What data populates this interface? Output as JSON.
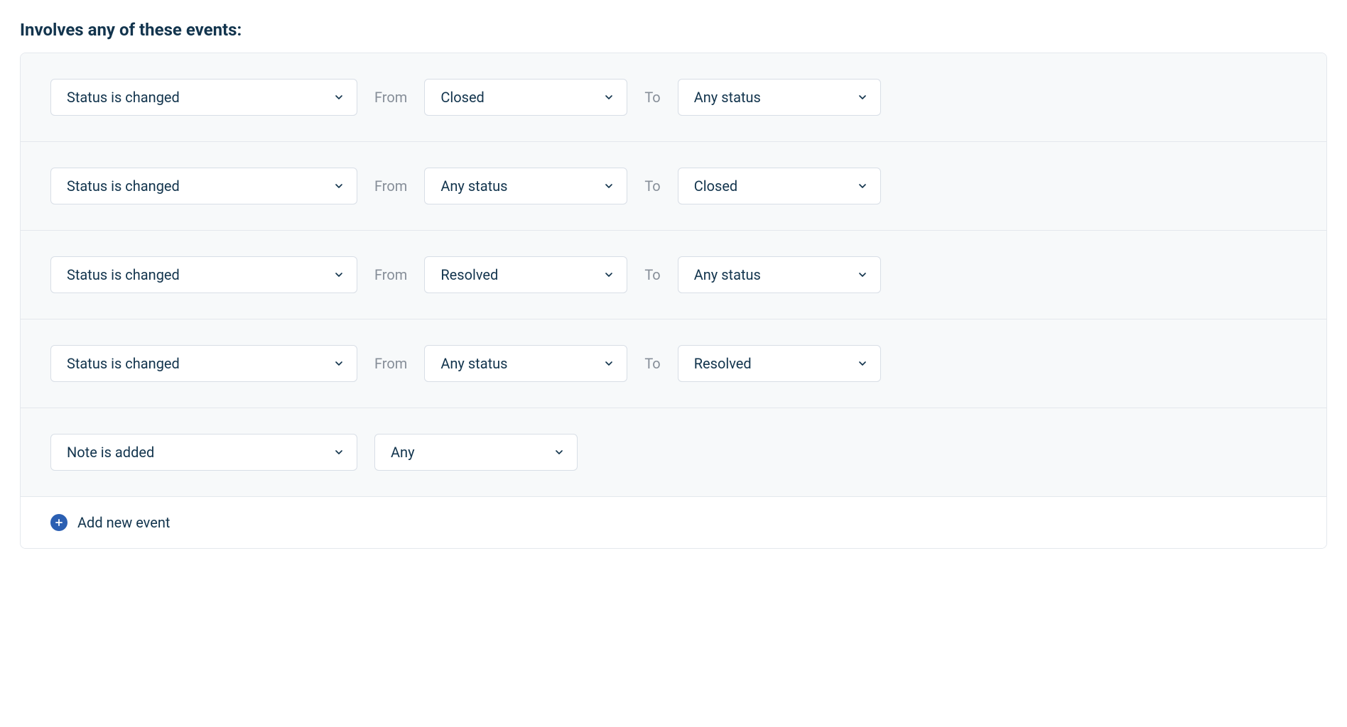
{
  "section_title": "Involves any of these events:",
  "labels": {
    "from": "From",
    "to": "To"
  },
  "events": [
    {
      "type": "status_change",
      "event_type_label": "Status is changed",
      "from_value": "Closed",
      "to_value": "Any status"
    },
    {
      "type": "status_change",
      "event_type_label": "Status is changed",
      "from_value": "Any status",
      "to_value": "Closed"
    },
    {
      "type": "status_change",
      "event_type_label": "Status is changed",
      "from_value": "Resolved",
      "to_value": "Any status"
    },
    {
      "type": "status_change",
      "event_type_label": "Status is changed",
      "from_value": "Any status",
      "to_value": "Resolved"
    },
    {
      "type": "note_added",
      "event_type_label": "Note is added",
      "scope_value": "Any"
    }
  ],
  "footer": {
    "add_event_label": "Add new event"
  }
}
